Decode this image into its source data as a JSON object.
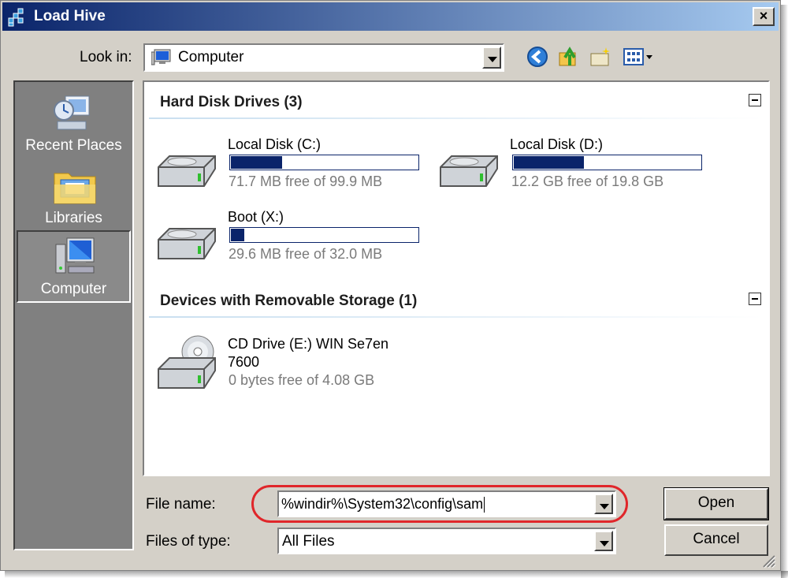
{
  "window": {
    "title": "Load Hive",
    "close_label": "×"
  },
  "toolbar": {
    "look_in_label": "Look in:",
    "look_in_value": "Computer",
    "icons": [
      "back-icon",
      "up-folder-icon",
      "new-folder-icon",
      "view-menu-icon"
    ]
  },
  "places": [
    {
      "label": "Recent Places",
      "icon": "recent-places-icon",
      "selected": false
    },
    {
      "label": "Libraries",
      "icon": "libraries-icon",
      "selected": false
    },
    {
      "label": "Computer",
      "icon": "computer-icon",
      "selected": true
    }
  ],
  "groups": {
    "hard_disks": {
      "title": "Hard Disk Drives (3)",
      "drives": [
        {
          "name": "Local Disk (C:)",
          "free": "71.7 MB free of 99.9 MB",
          "used_fraction": 0.28
        },
        {
          "name": "Local Disk (D:)",
          "free": "12.2 GB free of 19.8 GB",
          "used_fraction": 0.38
        },
        {
          "name": "Boot (X:)",
          "free": "29.6 MB free of 32.0 MB",
          "used_fraction": 0.08
        }
      ]
    },
    "removable": {
      "title": "Devices with Removable Storage (1)",
      "drives": [
        {
          "name_line1": "CD Drive (E:) WIN Se7en",
          "name_line2": "7600",
          "free": "0 bytes free of 4.08 GB"
        }
      ]
    }
  },
  "form": {
    "file_name_label": "File name:",
    "file_name_value": "%windir%\\System32\\config\\sam",
    "file_type_label": "Files of type:",
    "file_type_value": "All Files",
    "open_label": "Open",
    "cancel_label": "Cancel"
  },
  "colors": {
    "highlight": "#e0262a",
    "bar_fill": "#0a246a"
  }
}
